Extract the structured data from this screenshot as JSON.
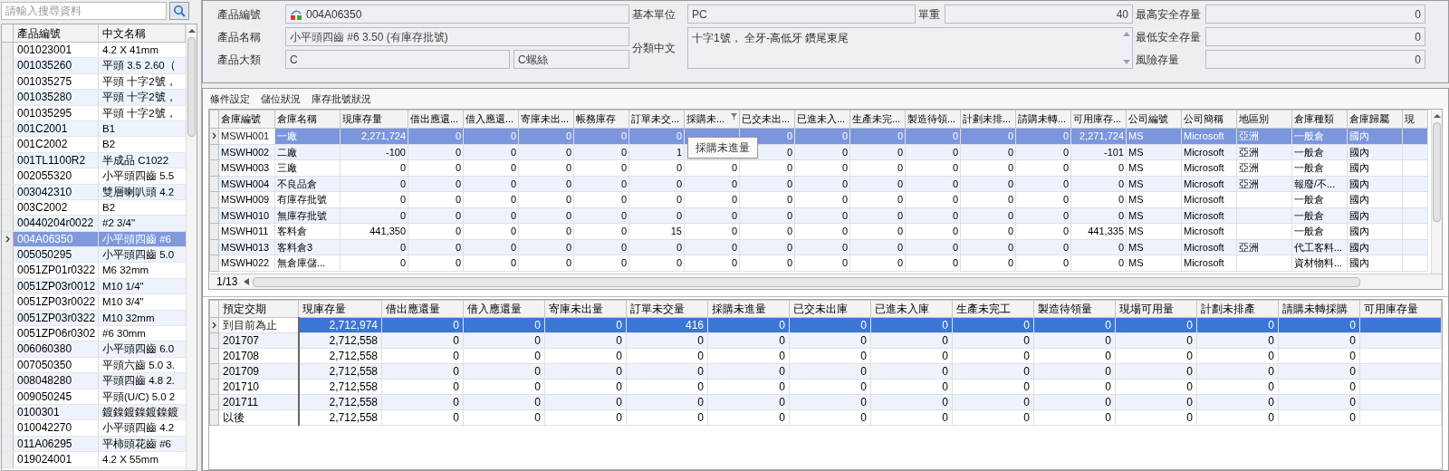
{
  "product_list": {
    "search": {
      "placeholder": "請輸入搜尋資料"
    },
    "columns": [
      "產品編號",
      "中文名稱"
    ],
    "rows": [
      {
        "code": "001023001",
        "name": "4.2 X 41mm",
        "selected": false
      },
      {
        "code": "001035260",
        "name": "平頭 3.5 2.60（",
        "selected": false
      },
      {
        "code": "001035275",
        "name": "平頭 十字2號，",
        "selected": false
      },
      {
        "code": "001035280",
        "name": "平頭 十字2號，",
        "selected": false
      },
      {
        "code": "001035295",
        "name": "平頭 十字2號，",
        "selected": false
      },
      {
        "code": "001C2001",
        "name": "B1",
        "selected": false
      },
      {
        "code": "001C2002",
        "name": "B2",
        "selected": false
      },
      {
        "code": "001TL1100R2",
        "name": "半成品 C1022",
        "selected": false
      },
      {
        "code": "002055320",
        "name": "小平頭四齒 5.5",
        "selected": false
      },
      {
        "code": "003042310",
        "name": "雙層喇叭頭 4.2",
        "selected": false
      },
      {
        "code": "003C2002",
        "name": "B2",
        "selected": false
      },
      {
        "code": "00440204r0022",
        "name": "#2 3/4\"",
        "selected": false
      },
      {
        "code": "004A06350",
        "name": "小平頭四齒 #6",
        "selected": true
      },
      {
        "code": "005050295",
        "name": "小平頭四齒 5.0",
        "selected": false
      },
      {
        "code": "0051ZP01r0322",
        "name": "M6 32mm",
        "selected": false
      },
      {
        "code": "0051ZP03r0012",
        "name": "M10 1/4\"",
        "selected": false
      },
      {
        "code": "0051ZP03r0022",
        "name": "M10 3/4\"",
        "selected": false
      },
      {
        "code": "0051ZP03r0322",
        "name": "M10 32mm",
        "selected": false
      },
      {
        "code": "0051ZP06r0302",
        "name": "#6 30mm",
        "selected": false
      },
      {
        "code": "006060380",
        "name": "小平頭四齒 6.0",
        "selected": false
      },
      {
        "code": "007050350",
        "name": "平頭六齒 5.0 3.",
        "selected": false
      },
      {
        "code": "008048280",
        "name": "平頭四齒 4.8 2.",
        "selected": false
      },
      {
        "code": "009050245",
        "name": "平頭(U/C) 5.0 2",
        "selected": false
      },
      {
        "code": "0100301",
        "name": "鍍鎳鍍鎳鍍鎳鍍",
        "selected": false
      },
      {
        "code": "010042270",
        "name": "小平頭四齒 4.2",
        "selected": false
      },
      {
        "code": "011A06295",
        "name": "平柿頭花齒 #6",
        "selected": false
      },
      {
        "code": "019024001",
        "name": "4.2 X 55mm",
        "selected": false
      }
    ]
  },
  "form": {
    "product_code": {
      "label": "產品編號",
      "value": "004A06350"
    },
    "base_unit": {
      "label": "基本單位",
      "value": "PC"
    },
    "unit_weight": {
      "label": "單重",
      "value": "40"
    },
    "max_safety_stock": {
      "label": "最高安全存量",
      "value": "0"
    },
    "product_name": {
      "label": "產品名稱",
      "value": "小平頭四齒 #6 3.50 (有庫存批號)"
    },
    "category_text": {
      "label": "分類中文",
      "value": "十字1號， 全牙-高低牙 鑽尾東尾"
    },
    "min_safety_stock": {
      "label": "最低安全存量",
      "value": "0"
    },
    "category": {
      "label": "產品大類",
      "value": "C",
      "value_name": "C螺絲"
    },
    "risk_stock": {
      "label": "風險存量",
      "value": "0"
    }
  },
  "sections": [
    "條件設定",
    "儲位狀況",
    "庫存批號狀況"
  ],
  "warehouse_table": {
    "pager": "1/13",
    "tooltip": "採購未進量",
    "columns": [
      {
        "label": "倉庫編號",
        "kind": "text",
        "filter": false
      },
      {
        "label": "倉庫名稱",
        "kind": "text",
        "filter": false
      },
      {
        "label": "現庫存量",
        "kind": "number",
        "filter": false
      },
      {
        "label": "借出應還...",
        "kind": "number",
        "filter": false
      },
      {
        "label": "借入應還...",
        "kind": "number",
        "filter": false
      },
      {
        "label": "寄庫未出...",
        "kind": "number",
        "filter": false
      },
      {
        "label": "帳務庫存",
        "kind": "number",
        "filter": false
      },
      {
        "label": "訂單未交...",
        "kind": "number",
        "filter": false
      },
      {
        "label": "採購未...",
        "kind": "number",
        "filter": true
      },
      {
        "label": "已交未出...",
        "kind": "number",
        "filter": false
      },
      {
        "label": "已進未入...",
        "kind": "number",
        "filter": false
      },
      {
        "label": "生產未完...",
        "kind": "number",
        "filter": false
      },
      {
        "label": "製造待領...",
        "kind": "number",
        "filter": false
      },
      {
        "label": "計劃未排...",
        "kind": "number",
        "filter": false
      },
      {
        "label": "請購未轉...",
        "kind": "number",
        "filter": false
      },
      {
        "label": "可用庫存...",
        "kind": "number",
        "filter": false
      },
      {
        "label": "公司編號",
        "kind": "text",
        "filter": false
      },
      {
        "label": "公司簡稱",
        "kind": "text",
        "filter": false
      },
      {
        "label": "地區別",
        "kind": "text",
        "filter": false
      },
      {
        "label": "倉庫種類",
        "kind": "text",
        "filter": false
      },
      {
        "label": "倉庫歸屬",
        "kind": "text",
        "filter": false
      },
      {
        "label": "現",
        "kind": "text",
        "filter": false
      }
    ],
    "rows": [
      {
        "selected": true,
        "cells": [
          "MSWH001",
          "一廠",
          "2,271,724",
          "0",
          "0",
          "0",
          "0",
          "0",
          null,
          "0",
          "0",
          "0",
          "0",
          "0",
          "0",
          "2,271,724",
          "MS",
          "Microsoft",
          "亞洲",
          "一般倉",
          "國內",
          null
        ]
      },
      {
        "selected": false,
        "cells": [
          "MSWH002",
          "二廠",
          "-100",
          "0",
          "0",
          "0",
          "0",
          "1",
          null,
          "0",
          "0",
          "0",
          "0",
          "0",
          "0",
          "-101",
          "MS",
          "Microsoft",
          "亞洲",
          "一般倉",
          "國內",
          null
        ]
      },
      {
        "selected": false,
        "cells": [
          "MSWH003",
          "三廠",
          "0",
          "0",
          "0",
          "0",
          "0",
          "0",
          "0",
          "0",
          "0",
          "0",
          "0",
          "0",
          "0",
          "0",
          "MS",
          "Microsoft",
          "亞洲",
          "一般倉",
          "國內",
          null
        ]
      },
      {
        "selected": false,
        "cells": [
          "MSWH004",
          "不良品倉",
          "0",
          "0",
          "0",
          "0",
          "0",
          "0",
          "0",
          "0",
          "0",
          "0",
          "0",
          "0",
          "0",
          "0",
          "MS",
          "Microsoft",
          "亞洲",
          "報廢/不...",
          "國內",
          null
        ]
      },
      {
        "selected": false,
        "cells": [
          "MSWH009",
          "有庫存批號",
          "0",
          "0",
          "0",
          "0",
          "0",
          "0",
          "0",
          "0",
          "0",
          "0",
          "0",
          "0",
          "0",
          "0",
          "MS",
          "Microsoft",
          null,
          "一般倉",
          "國內",
          null
        ]
      },
      {
        "selected": false,
        "cells": [
          "MSWH010",
          "無庫存批號",
          "0",
          "0",
          "0",
          "0",
          "0",
          "0",
          "0",
          "0",
          "0",
          "0",
          "0",
          "0",
          "0",
          "0",
          "MS",
          "Microsoft",
          null,
          "一般倉",
          "國內",
          null
        ]
      },
      {
        "selected": false,
        "cells": [
          "MSWH011",
          "客料倉",
          "441,350",
          "0",
          "0",
          "0",
          "0",
          "15",
          "0",
          "0",
          "0",
          "0",
          "0",
          "0",
          "0",
          "441,335",
          "MS",
          "Microsoft",
          null,
          "一般倉",
          "國內",
          null
        ]
      },
      {
        "selected": false,
        "cells": [
          "MSWH013",
          "客料倉3",
          "0",
          "0",
          "0",
          "0",
          "0",
          "0",
          "0",
          "0",
          "0",
          "0",
          "0",
          "0",
          "0",
          "0",
          "MS",
          "Microsoft",
          "亞洲",
          "代工客料...",
          "國內",
          null
        ]
      },
      {
        "selected": false,
        "cells": [
          "MSWH022",
          "無倉庫儲...",
          "0",
          "0",
          "0",
          "0",
          "0",
          "0",
          "0",
          "0",
          "0",
          "0",
          "0",
          "0",
          "0",
          "0",
          "MS",
          "Microsoft",
          null,
          "資材物料...",
          "國內",
          null
        ]
      }
    ]
  },
  "schedule_table": {
    "columns": [
      {
        "label": "預定交期",
        "kind": "text"
      },
      {
        "label": "現庫存量",
        "kind": "number"
      },
      {
        "label": "借出應還量",
        "kind": "number"
      },
      {
        "label": "借入應還量",
        "kind": "number"
      },
      {
        "label": "寄庫未出量",
        "kind": "number"
      },
      {
        "label": "訂單未交量",
        "kind": "number"
      },
      {
        "label": "採購未進量",
        "kind": "number"
      },
      {
        "label": "已交未出庫",
        "kind": "number"
      },
      {
        "label": "已進未入庫",
        "kind": "number"
      },
      {
        "label": "生產未完工",
        "kind": "number"
      },
      {
        "label": "製造待領量",
        "kind": "number"
      },
      {
        "label": "現場可用量",
        "kind": "number"
      },
      {
        "label": "計劃未排產",
        "kind": "number"
      },
      {
        "label": "請購未轉採購",
        "kind": "number"
      },
      {
        "label": "可用庫存量",
        "kind": "number"
      }
    ],
    "rows": [
      {
        "selected": true,
        "cells": [
          "到目前為止",
          "2,712,974",
          "0",
          "0",
          "0",
          "416",
          "0",
          "0",
          "0",
          "0",
          "0",
          "0",
          "0",
          "0",
          null
        ]
      },
      {
        "selected": false,
        "cells": [
          "201707",
          "2,712,558",
          "0",
          "0",
          "0",
          "0",
          "0",
          "0",
          "0",
          "0",
          "0",
          "0",
          "0",
          "0",
          null
        ]
      },
      {
        "selected": false,
        "cells": [
          "201708",
          "2,712,558",
          "0",
          "0",
          "0",
          "0",
          "0",
          "0",
          "0",
          "0",
          "0",
          "0",
          "0",
          "0",
          null
        ]
      },
      {
        "selected": false,
        "cells": [
          "201709",
          "2,712,558",
          "0",
          "0",
          "0",
          "0",
          "0",
          "0",
          "0",
          "0",
          "0",
          "0",
          "0",
          "0",
          null
        ]
      },
      {
        "selected": false,
        "cells": [
          "201710",
          "2,712,558",
          "0",
          "0",
          "0",
          "0",
          "0",
          "0",
          "0",
          "0",
          "0",
          "0",
          "0",
          "0",
          null
        ]
      },
      {
        "selected": false,
        "cells": [
          "201711",
          "2,712,558",
          "0",
          "0",
          "0",
          "0",
          "0",
          "0",
          "0",
          "0",
          "0",
          "0",
          "0",
          "0",
          null
        ]
      },
      {
        "selected": false,
        "cells": [
          "以後",
          "2,712,558",
          "0",
          "0",
          "0",
          "0",
          "0",
          "0",
          "0",
          "0",
          "0",
          "0",
          "0",
          "0",
          null
        ]
      }
    ]
  }
}
